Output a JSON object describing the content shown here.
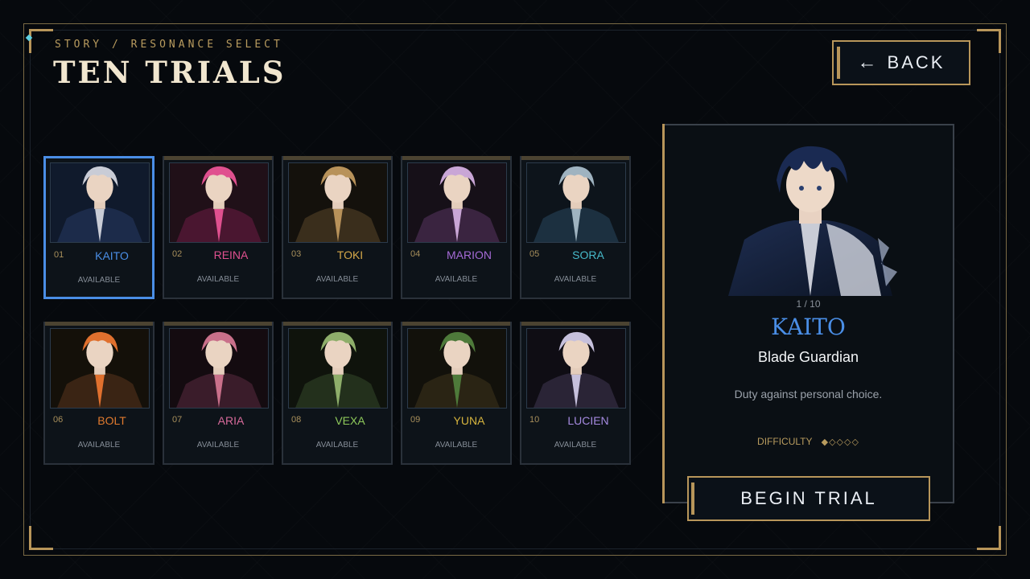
{
  "header": {
    "breadcrumb": "STORY / RESONANCE SELECT",
    "title": "TEN TRIALS",
    "back_label": "BACK"
  },
  "characters": [
    {
      "num": "01",
      "name": "KAITO",
      "status": "AVAILABLE",
      "color": "#4a8ee6",
      "palette": [
        "#1c2b4a",
        "#c9ccd6",
        "#101a2c"
      ],
      "selected": true
    },
    {
      "num": "02",
      "name": "REINA",
      "status": "AVAILABLE",
      "color": "#e0508f",
      "palette": [
        "#4a1630",
        "#e0508f",
        "#201018"
      ]
    },
    {
      "num": "03",
      "name": "TOKI",
      "status": "AVAILABLE",
      "color": "#d6a94a",
      "palette": [
        "#3a2e1c",
        "#b8925a",
        "#14110c"
      ]
    },
    {
      "num": "04",
      "name": "MARION",
      "status": "AVAILABLE",
      "color": "#a56ad6",
      "palette": [
        "#3a2440",
        "#c9a6d6",
        "#161018"
      ]
    },
    {
      "num": "05",
      "name": "SORA",
      "status": "AVAILABLE",
      "color": "#46b9c9",
      "palette": [
        "#1c3040",
        "#9fb3c0",
        "#0d141b"
      ]
    },
    {
      "num": "06",
      "name": "BOLT",
      "status": "AVAILABLE",
      "color": "#e07a2e",
      "palette": [
        "#3a2414",
        "#e0702e",
        "#141009"
      ]
    },
    {
      "num": "07",
      "name": "ARIA",
      "status": "AVAILABLE",
      "color": "#d66a9a",
      "palette": [
        "#3a1c2a",
        "#c9708a",
        "#140b10"
      ]
    },
    {
      "num": "08",
      "name": "VEXA",
      "status": "AVAILABLE",
      "color": "#8ec95a",
      "palette": [
        "#23301c",
        "#8eae6a",
        "#0f130c"
      ]
    },
    {
      "num": "09",
      "name": "YUNA",
      "status": "AVAILABLE",
      "color": "#d6b43e",
      "palette": [
        "#2a2414",
        "#4e7a3a",
        "#12110b"
      ]
    },
    {
      "num": "10",
      "name": "LUCIEN",
      "status": "AVAILABLE",
      "color": "#a58ae0",
      "palette": [
        "#2a2436",
        "#c6c0dc",
        "#0f0d14"
      ]
    }
  ],
  "detail": {
    "index": "1 / 10",
    "name": "KAITO",
    "role": "Blade Guardian",
    "quote": "Duty against personal choice.",
    "difficulty_label": "DIFFICULTY",
    "difficulty": 1,
    "difficulty_max": 5,
    "difficulty_display": "◆◇◇◇◇",
    "name_color": "#4a8ee6"
  },
  "actions": {
    "begin_label": "BEGIN TRIAL"
  }
}
